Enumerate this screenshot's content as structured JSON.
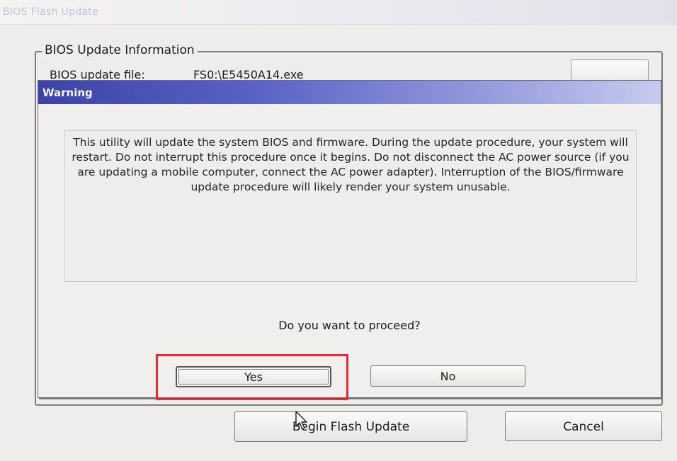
{
  "window": {
    "title": "BIOS Flash Update"
  },
  "update_info": {
    "legend": "BIOS Update Information",
    "file_label": "BIOS update file:",
    "file_value": "FS0:\\E5450A14.exe"
  },
  "dialog": {
    "title": "Warning",
    "message": "This utility will update the system BIOS and firmware. During the update procedure, your system will restart. Do not interrupt this procedure once it begins. Do not disconnect the AC power source (if you are updating a mobile computer, connect the AC power adapter). Interruption of the BIOS/firmware update procedure will likely render your system unusable.",
    "question": "Do you want to proceed?",
    "yes_label": "Yes",
    "no_label": "No"
  },
  "footer": {
    "begin_label": "Begin Flash Update",
    "cancel_label": "Cancel"
  },
  "colors": {
    "highlight": "#ea2a32",
    "dialog_title_bar": "#3c43a6"
  },
  "icons": {
    "cursor": "arrow-cursor-icon"
  }
}
